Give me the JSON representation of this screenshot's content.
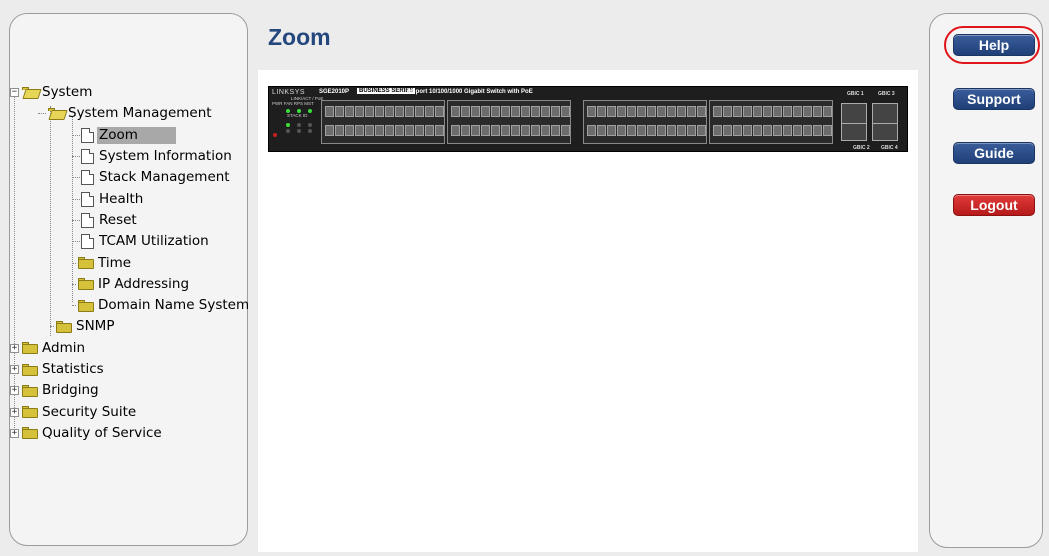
{
  "page": {
    "title": "Zoom"
  },
  "tree": {
    "items": [
      {
        "label": "System",
        "type": "folder-open",
        "expander": "−",
        "level": 0
      },
      {
        "label": "System Management",
        "type": "folder-open",
        "level": 1
      },
      {
        "label": "Zoom",
        "type": "doc",
        "level": 2,
        "selected": true
      },
      {
        "label": "System Information",
        "type": "doc",
        "level": 2
      },
      {
        "label": "Stack Management",
        "type": "doc",
        "level": 2
      },
      {
        "label": "Health",
        "type": "doc",
        "level": 2
      },
      {
        "label": "Reset",
        "type": "doc",
        "level": 2
      },
      {
        "label": "TCAM Utilization",
        "type": "doc",
        "level": 2
      },
      {
        "label": "Time",
        "type": "folder",
        "level": 2
      },
      {
        "label": "IP Addressing",
        "type": "folder",
        "level": 2
      },
      {
        "label": "Domain Name System",
        "type": "folder",
        "level": 2
      },
      {
        "label": "SNMP",
        "type": "folder",
        "level": 1
      },
      {
        "label": "Admin",
        "type": "folder",
        "expander": "+",
        "level": 0
      },
      {
        "label": "Statistics",
        "type": "folder",
        "expander": "+",
        "level": 0
      },
      {
        "label": "Bridging",
        "type": "folder",
        "expander": "+",
        "level": 0
      },
      {
        "label": "Security Suite",
        "type": "folder",
        "expander": "+",
        "level": 0
      },
      {
        "label": "Quality of Service",
        "type": "folder",
        "expander": "+",
        "level": 0
      }
    ]
  },
  "device": {
    "brand": "LINKSYS",
    "model": "SGE2010P",
    "series": "BUSINESS SERIES",
    "description": "48-port 10/100/1000 Gigabit Switch with PoE",
    "led_header": "PWR FAN RPS MST",
    "link_act_label": "LINK/ACT / PoE",
    "stack_id_label": "STACK ID",
    "gbic_labels": [
      "GBIC 1",
      "GBIC 2",
      "GBIC 3",
      "GBIC 4"
    ]
  },
  "nav": {
    "help": "Help",
    "support": "Support",
    "guide": "Guide",
    "logout": "Logout"
  },
  "colors": {
    "title": "#24477e",
    "nav_blue": "#2a4c88",
    "nav_red": "#cc2222",
    "highlight_ring": "#e0141b",
    "selected_bg": "#a8a8a8"
  }
}
